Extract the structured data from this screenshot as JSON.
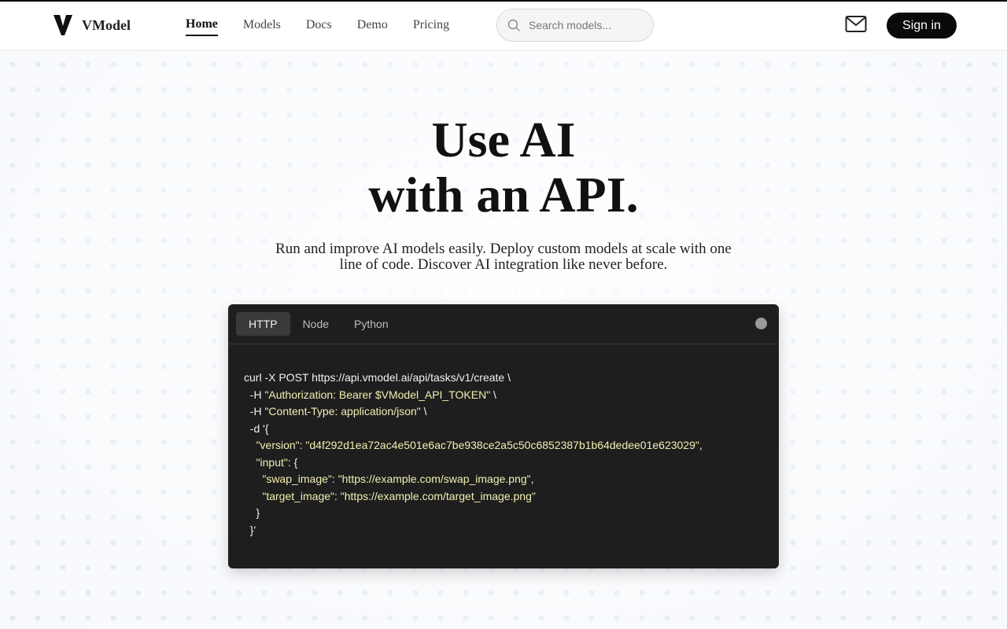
{
  "brand": {
    "name": "VModel"
  },
  "nav": {
    "items": [
      {
        "label": "Home",
        "active": true
      },
      {
        "label": "Models"
      },
      {
        "label": "Docs"
      },
      {
        "label": "Demo"
      },
      {
        "label": "Pricing"
      }
    ]
  },
  "search": {
    "placeholder": "Search models..."
  },
  "header": {
    "signin_label": "Sign in",
    "mail_icon": "mail-icon"
  },
  "hero": {
    "title_line1": "Use AI",
    "title_line2": "with an API.",
    "subtitle": "Run and improve AI models easily. Deploy custom models at scale with one line of code. Discover AI integration like never before."
  },
  "code": {
    "tabs": [
      {
        "label": "HTTP",
        "active": true
      },
      {
        "label": "Node"
      },
      {
        "label": "Python"
      }
    ],
    "lines": [
      {
        "plain": "curl -X POST https://api.vmodel.ai/api/tasks/v1/create \\"
      },
      {
        "pre": "  -H ",
        "str": "\"Authorization: Bearer $VModel_API_TOKEN\"",
        "post": " \\"
      },
      {
        "pre": "  -H ",
        "str": "\"Content-Type: application/json\"",
        "post": " \\"
      },
      {
        "plain": "  -d '{"
      },
      {
        "pre": "    ",
        "str": "\"version\"",
        "mid": ": ",
        "str2": "\"d4f292d1ea72ac4e501e6ac7be938ce2a5c50c6852387b1b64dedee01e623029\"",
        "post": ","
      },
      {
        "pre": "    ",
        "str": "\"input\"",
        "post": ": {"
      },
      {
        "pre": "      ",
        "str": "\"swap_image\"",
        "mid": ": ",
        "str2": "\"https://example.com/swap_image.png\"",
        "post": ","
      },
      {
        "pre": "      ",
        "str": "\"target_image\"",
        "mid": ": ",
        "str2": "\"https://example.com/target_image.png\""
      },
      {
        "plain": "    }"
      },
      {
        "plain": "  }'"
      }
    ]
  }
}
